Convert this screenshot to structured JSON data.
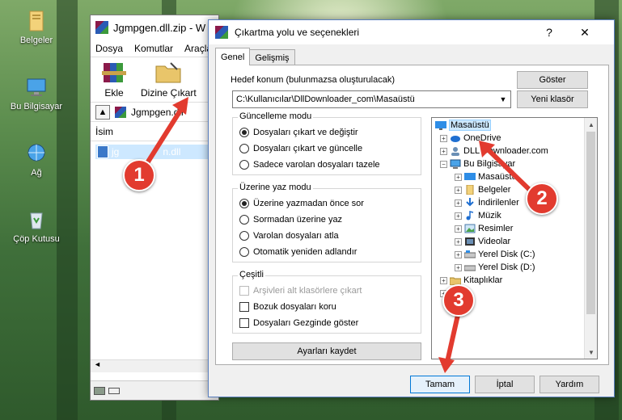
{
  "desktop": {
    "icons": [
      {
        "label": "Belgeler",
        "icon": "folder-icon"
      },
      {
        "label": "Bu Bilgisayar",
        "icon": "computer-icon"
      },
      {
        "label": "Ağ",
        "icon": "network-icon"
      },
      {
        "label": "Çöp Kutusu",
        "icon": "recycle-bin-icon"
      }
    ]
  },
  "winrar": {
    "title": "Jgmpgen.dll.zip - W",
    "menu": [
      "Dosya",
      "Komutlar",
      "Araçla"
    ],
    "toolbar": {
      "add_label": "Ekle",
      "extract_label": "Dizine Çıkart"
    },
    "path": "Jgmpgen.dll",
    "column_name": "İsim",
    "file": "jgmpgen.dll",
    "file_visible": "jg",
    "file_visible_end": "n.dll"
  },
  "dialog": {
    "title": "Çıkartma yolu ve seçenekleri",
    "help_glyph": "?",
    "close_glyph": "✕",
    "tabs": [
      "Genel",
      "Gelişmiş"
    ],
    "target_label": "Hedef konum (bulunmazsa oluşturulacak)",
    "target_value": "C:\\Kullanıcılar\\DllDownloader_com\\Masaüstü",
    "show_button": "Göster",
    "new_folder_button": "Yeni klasör",
    "update_mode": {
      "title": "Güncelleme modu",
      "options": [
        {
          "label": "Dosyaları çıkart ve değiştir",
          "selected": true
        },
        {
          "label": "Dosyaları çıkart ve güncelle",
          "selected": false
        },
        {
          "label": "Sadece varolan dosyaları tazele",
          "selected": false
        }
      ]
    },
    "overwrite_mode": {
      "title": "Üzerine yaz modu",
      "options": [
        {
          "label": "Üzerine yazmadan önce sor",
          "selected": true
        },
        {
          "label": "Sormadan üzerine yaz",
          "selected": false
        },
        {
          "label": "Varolan dosyaları atla",
          "selected": false
        },
        {
          "label": "Otomatik yeniden adlandır",
          "selected": false
        }
      ]
    },
    "misc": {
      "title": "Çeşitli",
      "options": [
        {
          "label": "Arşivleri alt klasörlere çıkart",
          "checked": false,
          "disabled": true
        },
        {
          "label": "Bozuk dosyaları koru",
          "checked": false,
          "disabled": false
        },
        {
          "label": "Dosyaları Gezginde göster",
          "checked": false,
          "disabled": false
        }
      ]
    },
    "save_settings_button": "Ayarları kaydet",
    "tree": [
      {
        "label": "Masaüstü",
        "level": 0,
        "selected": true,
        "expander": "",
        "icon": "desktop-icon"
      },
      {
        "label": "OneDrive",
        "level": 1,
        "expander": "+",
        "icon": "cloud-icon"
      },
      {
        "label": "DLL Downloader.com",
        "level": 1,
        "expander": "+",
        "icon": "user-icon"
      },
      {
        "label": "Bu Bilgisayar",
        "level": 1,
        "expander": "−",
        "icon": "computer-icon"
      },
      {
        "label": "Masaüstü",
        "level": 2,
        "expander": "+",
        "icon": "desktop-icon"
      },
      {
        "label": "Belgeler",
        "level": 2,
        "expander": "+",
        "icon": "documents-icon"
      },
      {
        "label": "İndirilenler",
        "level": 2,
        "expander": "+",
        "icon": "download-icon"
      },
      {
        "label": "Müzik",
        "level": 2,
        "expander": "+",
        "icon": "music-icon"
      },
      {
        "label": "Resimler",
        "level": 2,
        "expander": "+",
        "icon": "pictures-icon"
      },
      {
        "label": "Videolar",
        "level": 2,
        "expander": "+",
        "icon": "videos-icon"
      },
      {
        "label": "Yerel Disk (C:)",
        "level": 2,
        "expander": "+",
        "icon": "drive-icon"
      },
      {
        "label": "Yerel Disk (D:)",
        "level": 2,
        "expander": "+",
        "icon": "drive-icon"
      },
      {
        "label": "Kitaplıklar",
        "level": 1,
        "expander": "+",
        "icon": "library-icon"
      },
      {
        "label": "",
        "level": 1,
        "expander": "+",
        "icon": "network-icon"
      }
    ],
    "ok_button": "Tamam",
    "cancel_button": "İptal",
    "help_button": "Yardım"
  },
  "annotations": [
    "1",
    "2",
    "3"
  ],
  "colors": {
    "badge": "#e23b2f",
    "selection": "#cce8ff",
    "accent": "#0078d7"
  }
}
